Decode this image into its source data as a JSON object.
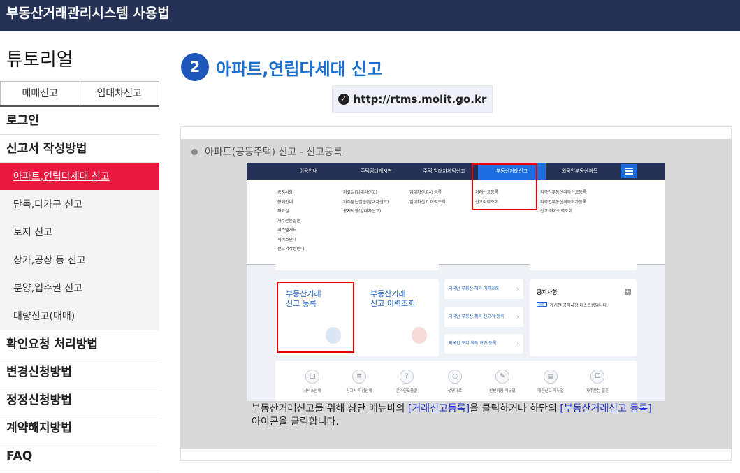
{
  "header": {
    "title": "부동산거래관리시스템 사용법"
  },
  "sidebar": {
    "title": "튜토리얼",
    "tabs": [
      "매매신고",
      "임대차신고"
    ],
    "items": [
      {
        "label": "로그인"
      },
      {
        "label": "신고서 작성방법"
      },
      {
        "label": "아파트,연립다세대 신고"
      },
      {
        "label": "단독,다가구 신고"
      },
      {
        "label": "토지 신고"
      },
      {
        "label": "상가,공장 등 신고"
      },
      {
        "label": "분양,입주권 신고"
      },
      {
        "label": "대량신고(매매)"
      },
      {
        "label": "확인요청 처리방법"
      },
      {
        "label": "변경신청방법"
      },
      {
        "label": "정정신청방법"
      },
      {
        "label": "계약해지방법"
      },
      {
        "label": "FAQ"
      }
    ],
    "active_color": "#e8183f"
  },
  "main": {
    "step_number": "2",
    "heading": "아파트,연립다세대 신고",
    "url": "http://rtms.molit.go.kr",
    "panel_title": "아파트(공동주택) 신고 - 신고등록",
    "caption": {
      "part1": "부동산거래신고를 위해 상단 메뉴바의 ",
      "link1": "[거래신고등록]",
      "part2": "을 클릭하거나 하단의 ",
      "link2": "[부동산거래신고 등록]",
      "part3": " 아이콘을 클릭합니다."
    }
  },
  "screenshot": {
    "nav": [
      "이용안내",
      "주택임대계시판",
      "주택 임대차계약신고",
      "부동산거래신고",
      "외국인부동산취득"
    ],
    "col1": [
      "공지사항",
      "장애안내",
      "자료실",
      "자주묻는질문",
      "시스템개요",
      "서비스안내",
      "신고서작성안내"
    ],
    "col2": [
      "자료실(임대차신고)",
      "자주묻는질문(임대차신고)",
      "공지사항(임대차신고)"
    ],
    "col3": [
      "임대차신고서 등록",
      "임대차신고 이력조회"
    ],
    "col4": [
      "거래신고등록",
      "신고이력조회"
    ],
    "col5": [
      "외국인부동산취득신고등록",
      "외국인부동산취득허가등록",
      "신고·허가이력조회"
    ],
    "card1": [
      "부동산거래",
      "신고 등록"
    ],
    "card2": [
      "부동산거래",
      "신고 이력조회"
    ],
    "links": [
      "외국인 부동산 허가 이력조회",
      "외국인 부동산 취득 신고서 등록",
      "외국인 토지 취득 허가 등록"
    ],
    "notice_title": "공지사항",
    "notice_badge": "일반",
    "notice_item": "게시판 공지사항 테스트중입니다.",
    "bottom_icons": [
      "서비스안내",
      "신고서 작성안내",
      "온라인도움말",
      "설명자료",
      "빈번이용 매뉴얼",
      "대량신고 매뉴얼",
      "자주묻는 질문"
    ]
  }
}
